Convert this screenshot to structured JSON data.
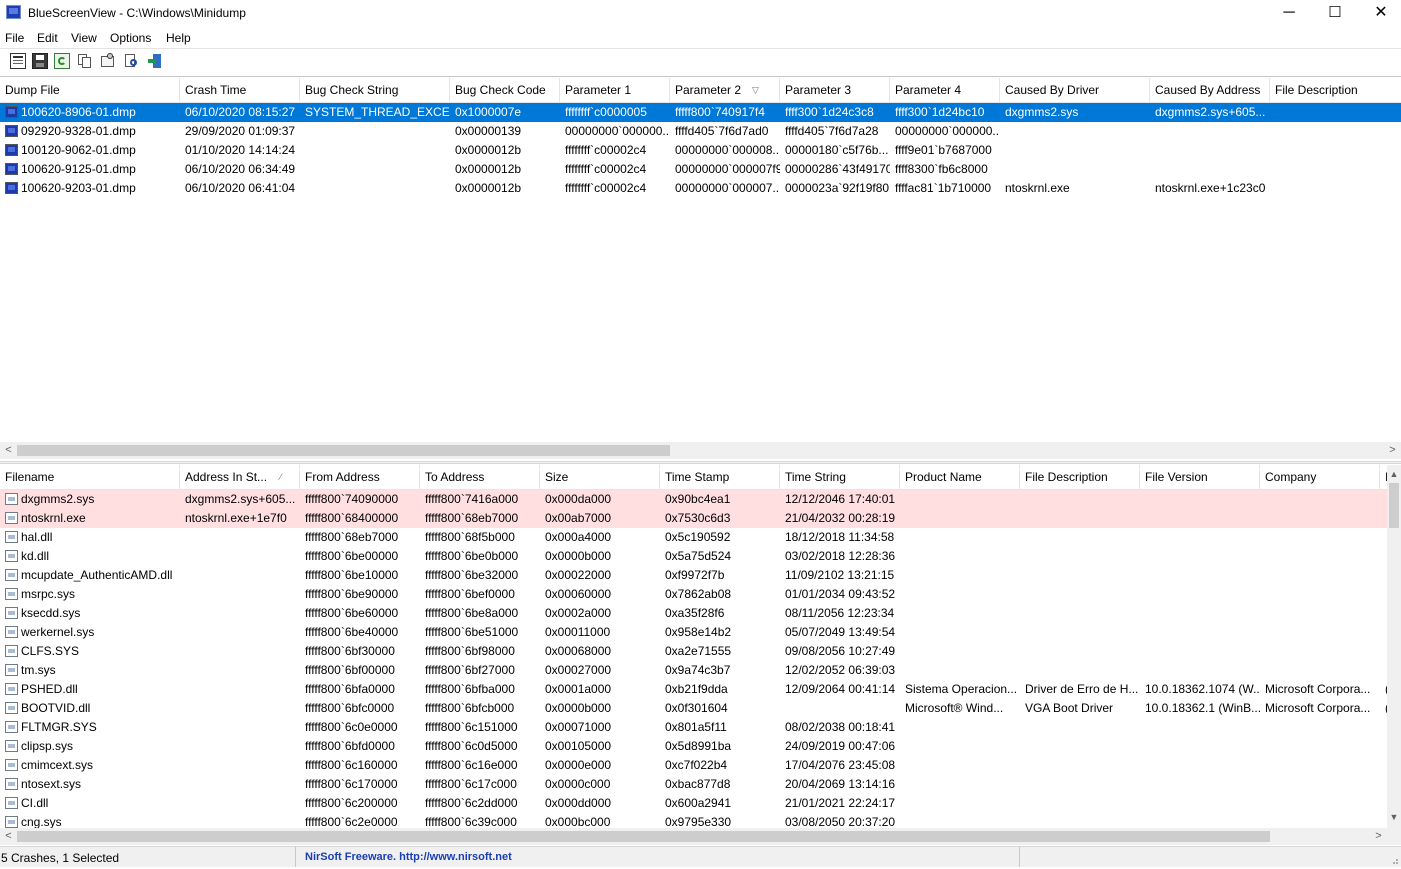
{
  "window": {
    "title": "BlueScreenView  -  C:\\Windows\\Minidump",
    "buttons": {
      "minimize": "─",
      "maximize": "☐",
      "close": "✕"
    }
  },
  "menu": [
    "File",
    "Edit",
    "View",
    "Options",
    "Help"
  ],
  "toolbar": [
    "html-report-icon",
    "save-icon",
    "refresh-icon",
    "copy-icon",
    "properties-icon",
    "find-icon",
    "exit-icon"
  ],
  "upper": {
    "columns": [
      "Dump File",
      "Crash Time",
      "Bug Check String",
      "Bug Check Code",
      "Parameter 1",
      "Parameter 2",
      "Parameter 3",
      "Parameter 4",
      "Caused By Driver",
      "Caused By Address",
      "File Description"
    ],
    "sort_column": "Parameter 2",
    "rows": [
      [
        "100620-8906-01.dmp",
        "06/10/2020 08:15:27",
        "SYSTEM_THREAD_EXCE...",
        "0x1000007e",
        "ffffffff`c0000005",
        "fffff800`740917f4",
        "ffff300`1d24c3c8",
        "ffff300`1d24bc10",
        "dxgmms2.sys",
        "dxgmms2.sys+605...",
        ""
      ],
      [
        "092920-9328-01.dmp",
        "29/09/2020 01:09:37",
        "",
        "0x00000139",
        "00000000`000000...",
        "ffffd405`7f6d7ad0",
        "ffffd405`7f6d7a28",
        "00000000`000000...",
        "",
        "",
        ""
      ],
      [
        "100120-9062-01.dmp",
        "01/10/2020 14:14:24",
        "",
        "0x0000012b",
        "ffffffff`c00002c4",
        "00000000`000008...",
        "00000180`c5f76b...",
        "ffff9e01`b7687000",
        "",
        "",
        ""
      ],
      [
        "100620-9125-01.dmp",
        "06/10/2020 06:34:49",
        "",
        "0x0000012b",
        "ffffffff`c00002c4",
        "00000000`000007f9",
        "00000286`43f49170",
        "ffff8300`fb6c8000",
        "",
        "",
        ""
      ],
      [
        "100620-9203-01.dmp",
        "06/10/2020 06:41:04",
        "",
        "0x0000012b",
        "ffffffff`c00002c4",
        "00000000`000007...",
        "0000023a`92f19f80",
        "ffffac81`1b710000",
        "ntoskrnl.exe",
        "ntoskrnl.exe+1c23c0",
        ""
      ]
    ],
    "selected_index": 0
  },
  "lower": {
    "columns": [
      "Filename",
      "Address In St...",
      "From Address",
      "To Address",
      "Size",
      "Time Stamp",
      "Time String",
      "Product Name",
      "File Description",
      "File Version",
      "Company",
      "I"
    ],
    "rows": [
      [
        "dxgmms2.sys",
        "dxgmms2.sys+605...",
        "fffff800`74090000",
        "fffff800`7416a000",
        "0x000da000",
        "0x90bc4ea1",
        "12/12/2046 17:40:01",
        "",
        "",
        "",
        "",
        ""
      ],
      [
        "ntoskrnl.exe",
        "ntoskrnl.exe+1e7f0",
        "fffff800`68400000",
        "fffff800`68eb7000",
        "0x00ab7000",
        "0x7530c6d3",
        "21/04/2032 00:28:19",
        "",
        "",
        "",
        "",
        ""
      ],
      [
        "hal.dll",
        "",
        "fffff800`68eb7000",
        "fffff800`68f5b000",
        "0x000a4000",
        "0x5c190592",
        "18/12/2018 11:34:58",
        "",
        "",
        "",
        "",
        ""
      ],
      [
        "kd.dll",
        "",
        "fffff800`6be00000",
        "fffff800`6be0b000",
        "0x0000b000",
        "0x5a75d524",
        "03/02/2018 12:28:36",
        "",
        "",
        "",
        "",
        ""
      ],
      [
        "mcupdate_AuthenticAMD.dll",
        "",
        "fffff800`6be10000",
        "fffff800`6be32000",
        "0x00022000",
        "0xf9972f7b",
        "11/09/2102 13:21:15",
        "",
        "",
        "",
        "",
        ""
      ],
      [
        "msrpc.sys",
        "",
        "fffff800`6be90000",
        "fffff800`6bef0000",
        "0x00060000",
        "0x7862ab08",
        "01/01/2034 09:43:52",
        "",
        "",
        "",
        "",
        ""
      ],
      [
        "ksecdd.sys",
        "",
        "fffff800`6be60000",
        "fffff800`6be8a000",
        "0x0002a000",
        "0xa35f28f6",
        "08/11/2056 12:23:34",
        "",
        "",
        "",
        "",
        ""
      ],
      [
        "werkernel.sys",
        "",
        "fffff800`6be40000",
        "fffff800`6be51000",
        "0x00011000",
        "0x958e14b2",
        "05/07/2049 13:49:54",
        "",
        "",
        "",
        "",
        ""
      ],
      [
        "CLFS.SYS",
        "",
        "fffff800`6bf30000",
        "fffff800`6bf98000",
        "0x00068000",
        "0xa2e71555",
        "09/08/2056 10:27:49",
        "",
        "",
        "",
        "",
        ""
      ],
      [
        "tm.sys",
        "",
        "fffff800`6bf00000",
        "fffff800`6bf27000",
        "0x00027000",
        "0x9a74c3b7",
        "12/02/2052 06:39:03",
        "",
        "",
        "",
        "",
        ""
      ],
      [
        "PSHED.dll",
        "",
        "fffff800`6bfa0000",
        "fffff800`6bfba000",
        "0x0001a000",
        "0xb21f9dda",
        "12/09/2064 00:41:14",
        "Sistema Operacion...",
        "Driver de Erro de H...",
        "10.0.18362.1074 (W...",
        "Microsoft Corpora...",
        "("
      ],
      [
        "BOOTVID.dll",
        "",
        "fffff800`6bfc0000",
        "fffff800`6bfcb000",
        "0x0000b000",
        "0x0f301604",
        "",
        "Microsoft® Wind...",
        "VGA Boot Driver",
        "10.0.18362.1 (WinB...",
        "Microsoft Corpora...",
        "("
      ],
      [
        "FLTMGR.SYS",
        "",
        "fffff800`6c0e0000",
        "fffff800`6c151000",
        "0x00071000",
        "0x801a5f11",
        "08/02/2038 00:18:41",
        "",
        "",
        "",
        "",
        ""
      ],
      [
        "clipsp.sys",
        "",
        "fffff800`6bfd0000",
        "fffff800`6c0d5000",
        "0x00105000",
        "0x5d8991ba",
        "24/09/2019 00:47:06",
        "",
        "",
        "",
        "",
        ""
      ],
      [
        "cmimcext.sys",
        "",
        "fffff800`6c160000",
        "fffff800`6c16e000",
        "0x0000e000",
        "0xc7f022b4",
        "17/04/2076 23:45:08",
        "",
        "",
        "",
        "",
        ""
      ],
      [
        "ntosext.sys",
        "",
        "fffff800`6c170000",
        "fffff800`6c17c000",
        "0x0000c000",
        "0xbac877d8",
        "20/04/2069 13:14:16",
        "",
        "",
        "",
        "",
        ""
      ],
      [
        "CI.dll",
        "",
        "fffff800`6c200000",
        "fffff800`6c2dd000",
        "0x000dd000",
        "0x600a2941",
        "21/01/2021 22:24:17",
        "",
        "",
        "",
        "",
        ""
      ],
      [
        "cng.sys",
        "",
        "fffff800`6c2e0000",
        "fffff800`6c39c000",
        "0x000bc000",
        "0x9795e330",
        "03/08/2050 20:37:20",
        "",
        "",
        "",
        "",
        ""
      ]
    ],
    "highlighted_count": 2
  },
  "status": {
    "left": "5 Crashes, 1 Selected",
    "middle": "NirSoft Freeware.  http://www.nirsoft.net"
  },
  "colors": {
    "selection": "#0078d7",
    "highlight": "#ffdfe0",
    "link": "#1b3fb5"
  }
}
